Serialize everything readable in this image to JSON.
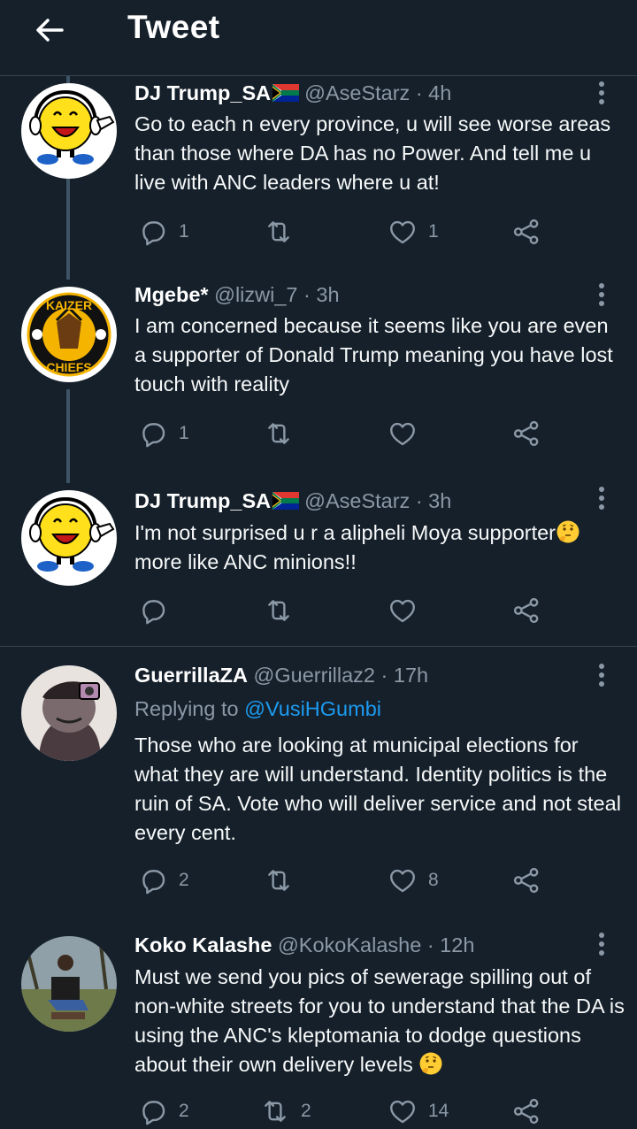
{
  "header": {
    "title": "Tweet"
  },
  "tweets": [
    {
      "name": "DJ Trump_SA",
      "handle": "@AseStarz",
      "time": "· 4h",
      "text": "Go to each n every province, u will see worse areas than those where DA has no Power. And tell me u live with ANC leaders where u at!",
      "replies": "1",
      "retweets": "",
      "likes": "1",
      "avatar_icon": "smiley-headphones-icon"
    },
    {
      "name": "Mgebe*",
      "handle": "@lizwi_7",
      "time": "· 3h",
      "text": "I am concerned because it seems like you are even a supporter of Donald Trump meaning you have lost touch with reality",
      "replies": "1",
      "retweets": "",
      "likes": "",
      "avatar_icon": "kaizer-chiefs-logo"
    },
    {
      "name": "DJ Trump_SA",
      "handle": "@AseStarz",
      "time": "· 3h",
      "text": "I'm not surprised u r a alipheli Moya supporter",
      "text2": "more like ANC minions!!",
      "replies": "",
      "retweets": "",
      "likes": "",
      "avatar_icon": "smiley-headphones-icon"
    },
    {
      "name": "GuerrillaZA",
      "handle": "@Guerrillaz2",
      "time": "· 17h",
      "reply_prefix": "Replying to",
      "reply_target": "@VusiHGumbi",
      "text": "Those who are looking at municipal elections for what they are will understand. Identity politics is the ruin of SA. Vote who will deliver service and not steal every cent.",
      "replies": "2",
      "retweets": "",
      "likes": "8",
      "avatar_icon": "cartoon-character-avatar"
    },
    {
      "name": "Koko Kalashe",
      "handle": "@KokoKalashe",
      "time": "· 12h",
      "text": "Must we send you pics of sewerage spilling out of non-white streets for you to understand that the DA is using the ANC's kleptomania to dodge questions about their own delivery levels",
      "replies": "2",
      "retweets": "2",
      "likes": "14",
      "avatar_icon": "person-photo-avatar"
    }
  ],
  "colors": {
    "background": "#15202b",
    "muted": "#8b98a5",
    "link": "#1d9bf0",
    "divider": "#38444d"
  }
}
